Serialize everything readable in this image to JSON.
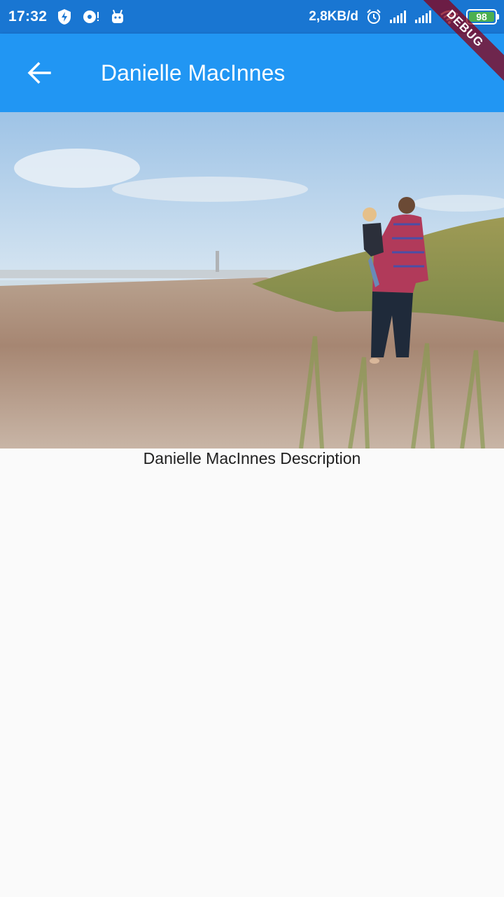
{
  "status_bar": {
    "time": "17:32",
    "network_rate": "2,8KB/d",
    "battery_level": "98"
  },
  "debug_banner": {
    "label": "DEBUG"
  },
  "app_bar": {
    "back_icon": "arrow-back-icon",
    "title": "Danielle MacInnes"
  },
  "hero_image": {
    "subject": "person-carrying-child-on-beach-photo"
  },
  "content": {
    "description": "Danielle MacInnes Description"
  },
  "colors": {
    "status_bar": "#1976d2",
    "app_bar": "#2196f3",
    "background": "#fafafa",
    "debug_banner": "#880015"
  }
}
